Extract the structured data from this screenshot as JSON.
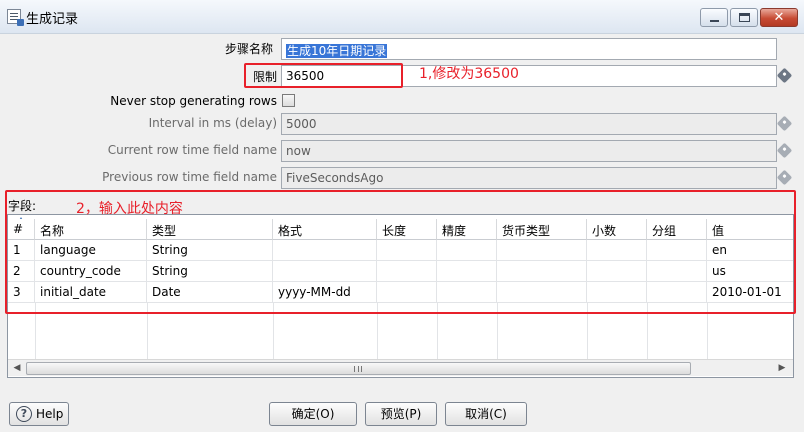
{
  "window": {
    "title": "生成记录"
  },
  "form": {
    "step_name_label": "步骤名称",
    "step_name_value": "生成10年日期记录",
    "limit_label": "限制",
    "limit_value": "36500",
    "never_stop_label": "Never stop generating rows",
    "never_stop_checked": false,
    "interval_label": "Interval in ms (delay)",
    "interval_value": "5000",
    "current_field_label": "Current row time field name",
    "current_field_value": "now",
    "previous_field_label": "Previous row time field name",
    "previous_field_value": "FiveSecondsAgo"
  },
  "annotations": {
    "limit_note": "1,修改为36500",
    "fields_note": "2，输入此处内容",
    "color": "#e8202a"
  },
  "fields_label": "字段:",
  "table": {
    "columns": [
      "#",
      "名称",
      "类型",
      "格式",
      "长度",
      "精度",
      "货币类型",
      "小数",
      "分组",
      "值"
    ],
    "rows": [
      [
        "1",
        "language",
        "String",
        "",
        "",
        "",
        "",
        "",
        "",
        "en"
      ],
      [
        "2",
        "country_code",
        "String",
        "",
        "",
        "",
        "",
        "",
        "",
        "us"
      ],
      [
        "3",
        "initial_date",
        "Date",
        "yyyy-MM-dd",
        "",
        "",
        "",
        "",
        "",
        "2010-01-01"
      ]
    ],
    "scroll_glyph": "Ⅲ"
  },
  "buttons": {
    "help": "Help",
    "ok": "确定(O)",
    "preview": "预览(P)",
    "cancel": "取消(C)"
  },
  "icons": {
    "app": "document-icon",
    "variable": "variable-diamond-icon",
    "help": "help-circle-icon"
  },
  "colors": {
    "selection": "#3875d7",
    "annotation": "#e8202a"
  }
}
